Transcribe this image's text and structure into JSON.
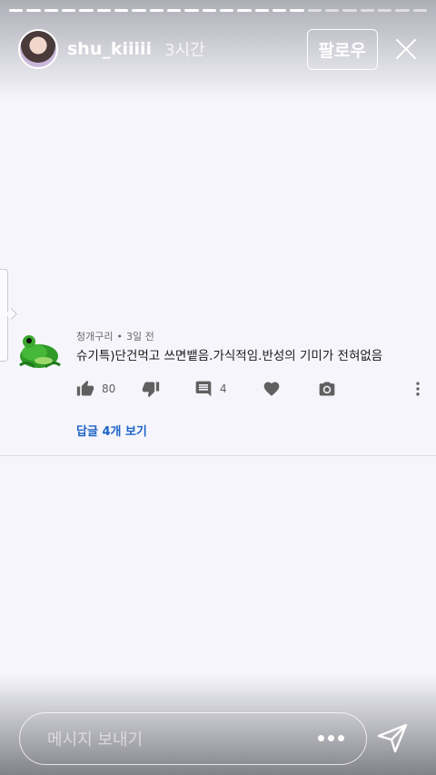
{
  "story": {
    "username": "shu_kiiiii",
    "time": "3시간",
    "follow_label": "팔로우",
    "progress_segments": 24,
    "progress_done": 17
  },
  "comment": {
    "author": "청개구리",
    "separator": "•",
    "age": "3일 전",
    "text": "슈기특)단건먹고 쓰면뱉음.가식적임.반성의 기미가 전혀없음",
    "likes": "80",
    "reply_count": "4",
    "view_replies": "답글 4개 보기"
  },
  "message": {
    "placeholder": "메시지 보내기"
  },
  "colors": {
    "background": "#f5f5fb",
    "link": "#1d63c7",
    "icon": "#606060"
  }
}
